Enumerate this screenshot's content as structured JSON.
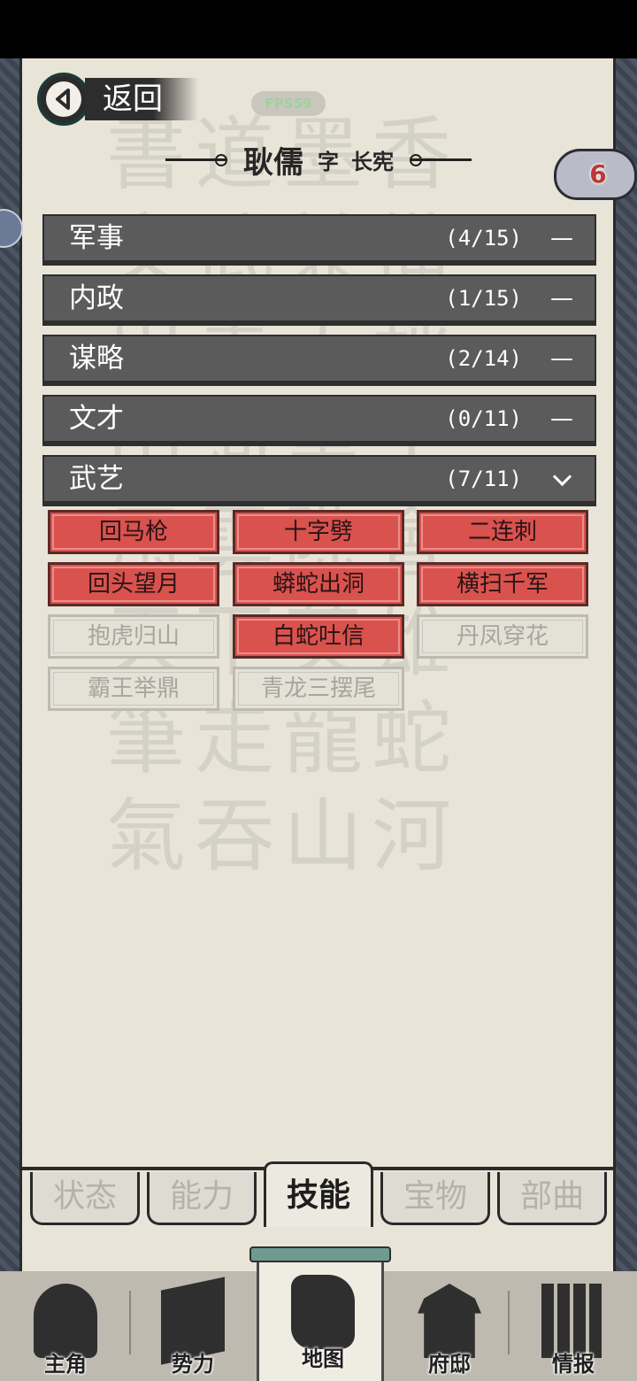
{
  "header": {
    "back_label": "返回",
    "fps": "FPS59",
    "character_name": "耿儒",
    "zi_label": "字",
    "style_name": "长宪",
    "badge_count": "6"
  },
  "categories": [
    {
      "name": "军事",
      "count": "(4/15)",
      "toggle": "—"
    },
    {
      "name": "内政",
      "count": "(1/15)",
      "toggle": "—"
    },
    {
      "name": "谋略",
      "count": "(2/14)",
      "toggle": "—"
    },
    {
      "name": "文才",
      "count": "(0/11)",
      "toggle": "—"
    },
    {
      "name": "武艺",
      "count": "(7/11)",
      "toggle": ""
    }
  ],
  "skills": [
    {
      "name": "回马枪",
      "learned": true
    },
    {
      "name": "十字劈",
      "learned": true
    },
    {
      "name": "二连刺",
      "learned": true
    },
    {
      "name": "回头望月",
      "learned": true
    },
    {
      "name": "蟒蛇出洞",
      "learned": true
    },
    {
      "name": "横扫千军",
      "learned": true
    },
    {
      "name": "抱虎归山",
      "learned": false
    },
    {
      "name": "白蛇吐信",
      "learned": true
    },
    {
      "name": "丹凤穿花",
      "learned": false
    },
    {
      "name": "霸王举鼎",
      "learned": false
    },
    {
      "name": "青龙三摆尾",
      "learned": false
    }
  ],
  "tabs": [
    {
      "label": "状态"
    },
    {
      "label": "能力"
    },
    {
      "label": "技能",
      "active": true
    },
    {
      "label": "宝物"
    },
    {
      "label": "部曲"
    }
  ],
  "bottom_nav": [
    {
      "label": "主角",
      "icon": "hero-icon"
    },
    {
      "label": "势力",
      "icon": "flag-icon"
    },
    {
      "label": "地图",
      "icon": "map-icon",
      "active": true
    },
    {
      "label": "府邸",
      "icon": "mansion-icon"
    },
    {
      "label": "情报",
      "icon": "scroll-icon"
    }
  ]
}
